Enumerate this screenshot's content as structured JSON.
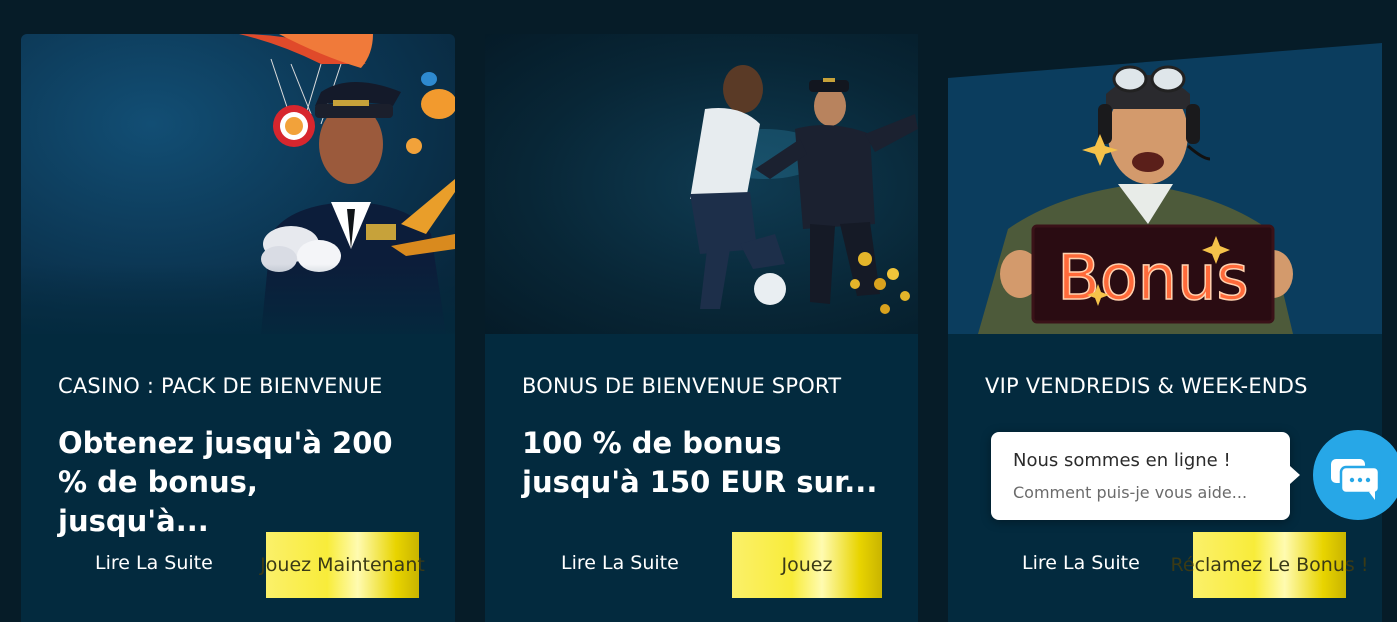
{
  "cards": [
    {
      "category": "CASINO : PACK DE BIENVENUE",
      "headline": "Obtenez jusqu'à 200 % de bonus, jusqu'à...",
      "read_more": "Lire La Suite",
      "cta": "Jouez Maintenant"
    },
    {
      "category": "BONUS DE BIENVENUE SPORT",
      "headline": "100 % de bonus jusqu'à 150 EUR sur...",
      "read_more": "Lire La Suite",
      "cta": "Jouez"
    },
    {
      "category": "VIP VENDREDIS & WEEK-ENDS",
      "headline": "",
      "read_more": "Lire La Suite",
      "cta": "Réclamez Le Bonus !",
      "sign_text": "Bonus"
    }
  ],
  "chat": {
    "title": "Nous sommes en ligne !",
    "subtitle": "Comment puis-je vous aide...",
    "icon": "chat-bubbles-icon"
  },
  "colors": {
    "background": "#061c28",
    "card_body": "#032a3e",
    "cta_gold": "#f8ec3a",
    "chat_blue": "#27a7e7",
    "neon_sign": "#ff5a2a"
  }
}
